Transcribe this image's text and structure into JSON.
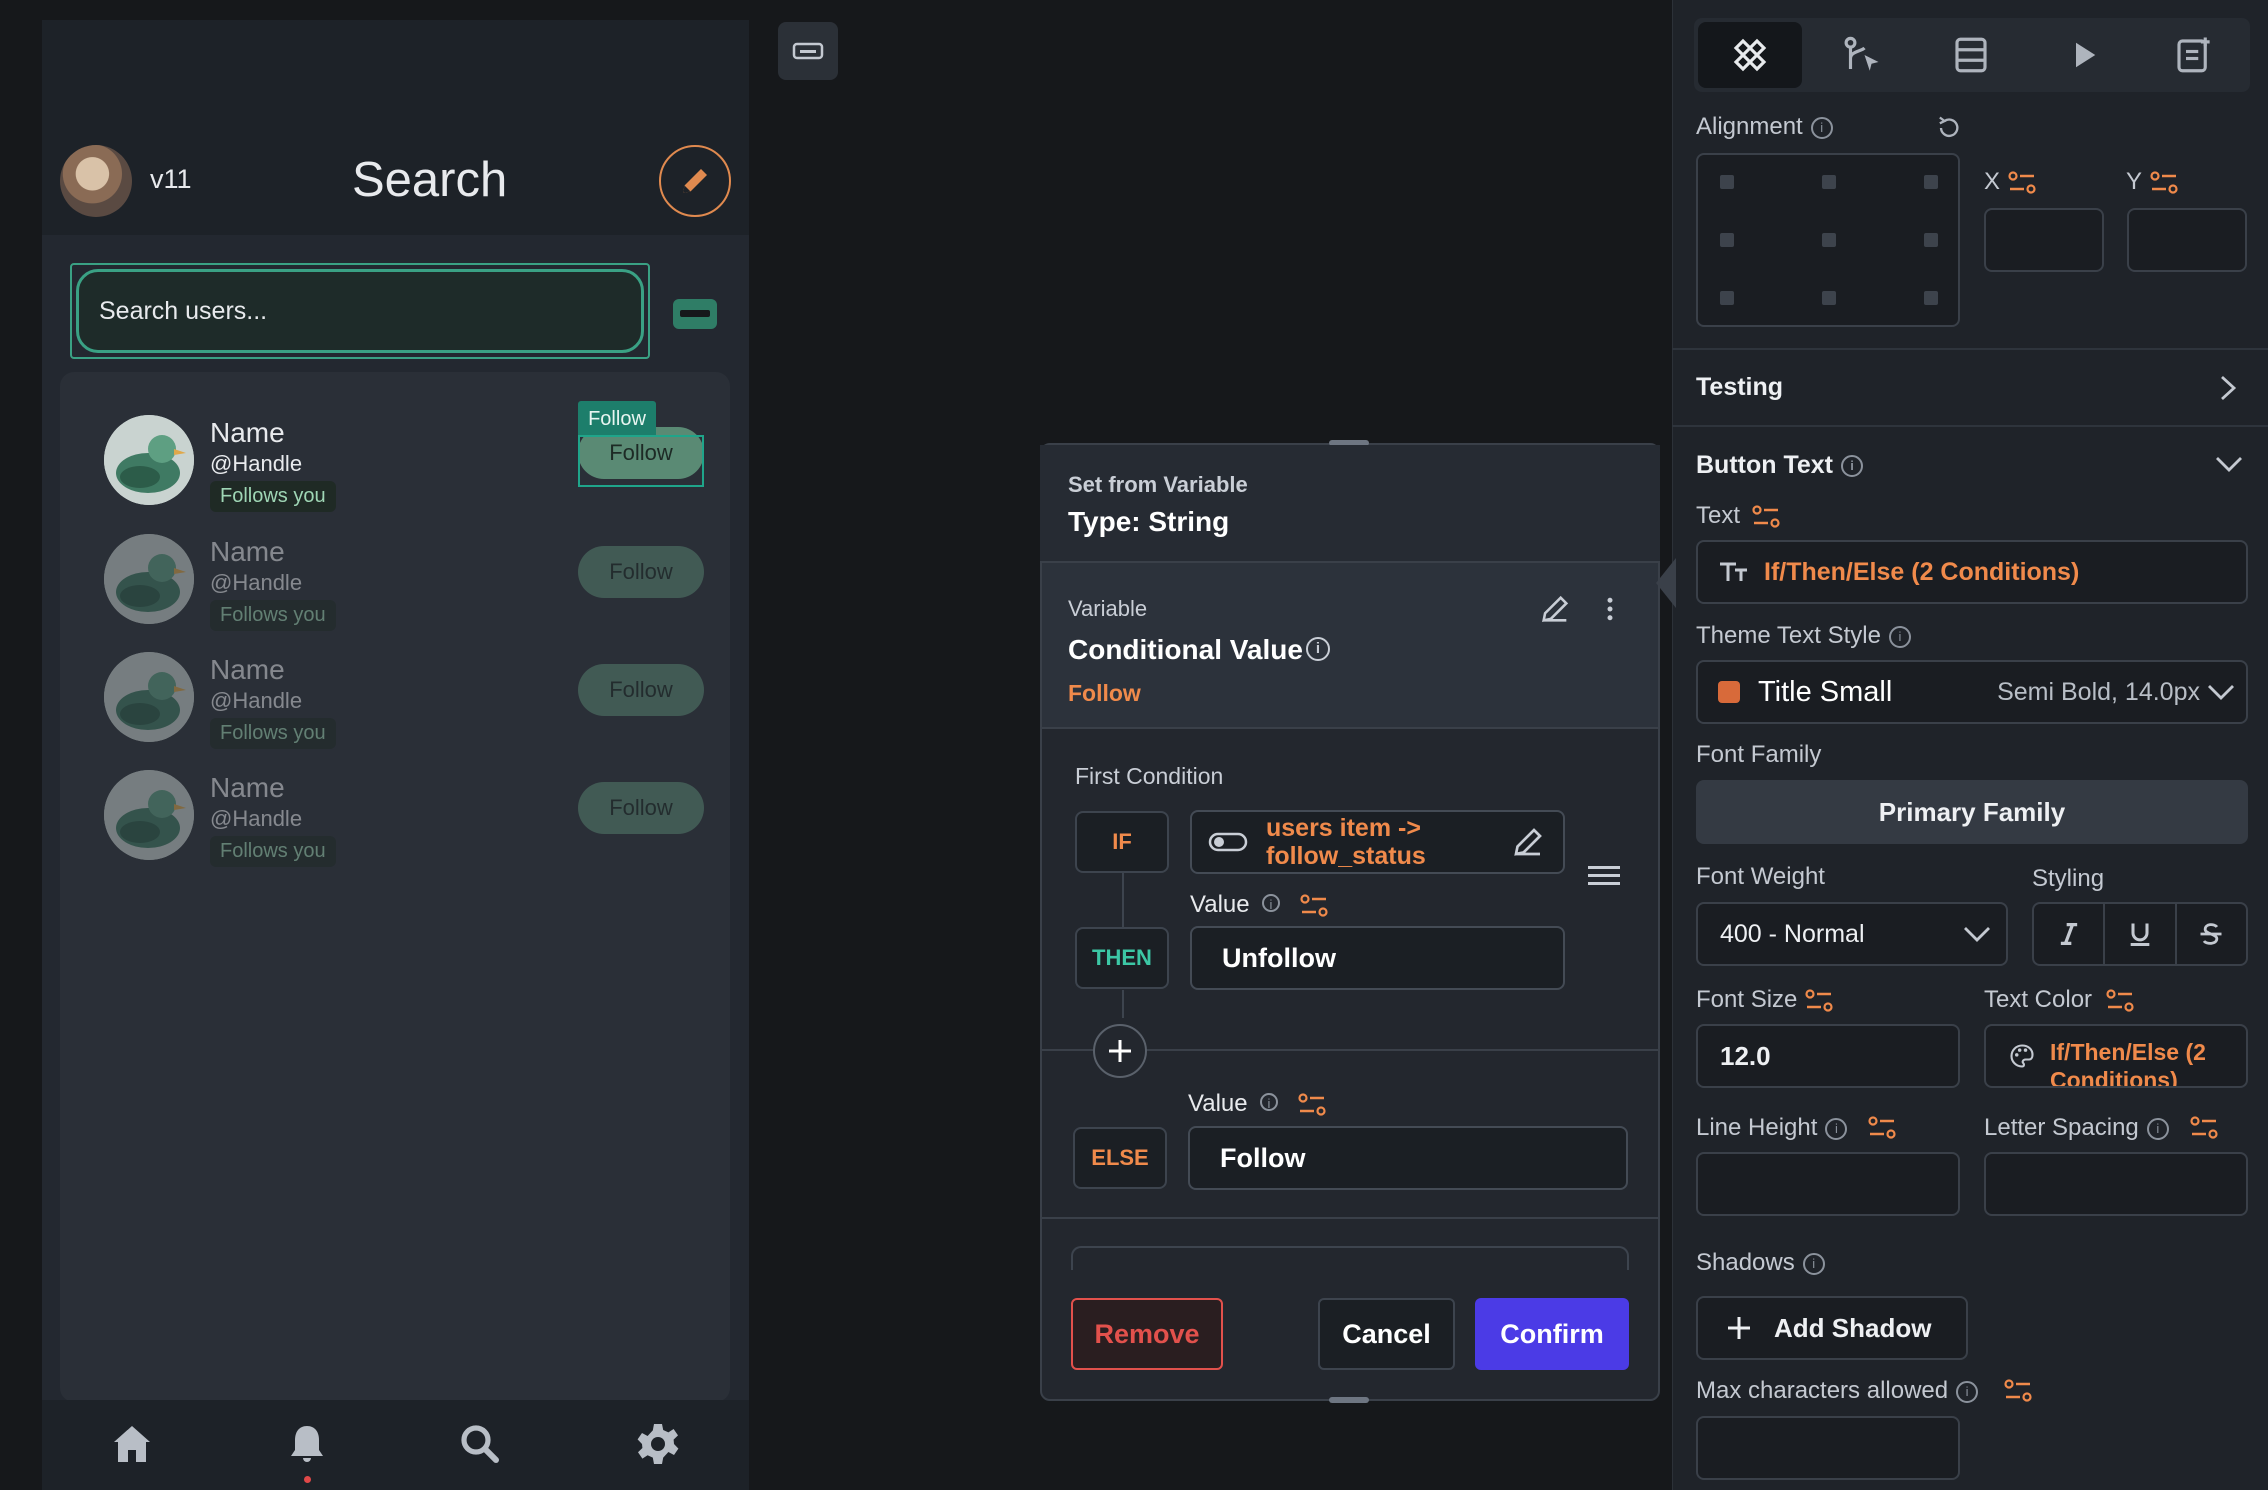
{
  "phone": {
    "version": "v11",
    "title": "Search",
    "search_placeholder": "Search users...",
    "follow_tag": "Follow",
    "users": [
      {
        "name": "Name",
        "handle": "@Handle",
        "badge": "Follows you",
        "button": "Follow"
      },
      {
        "name": "Name",
        "handle": "@Handle",
        "badge": "Follows you",
        "button": "Follow"
      },
      {
        "name": "Name",
        "handle": "@Handle",
        "badge": "Follows you",
        "button": "Follow"
      },
      {
        "name": "Name",
        "handle": "@Handle",
        "badge": "Follows you",
        "button": "Follow"
      }
    ],
    "nav_icons": [
      "home-icon",
      "bell-icon",
      "search-icon",
      "gear-icon"
    ]
  },
  "dialog": {
    "header_label": "Set from Variable",
    "header_type": "Type: String",
    "variable_label": "Variable",
    "variable_name": "Conditional Value",
    "variable_value": "Follow",
    "first_condition": "First Condition",
    "if_label": "IF",
    "if_source_line1": "users item ->",
    "if_source_line2": "follow_status",
    "value_label": "Value",
    "then_label": "THEN",
    "then_value": "Unfollow",
    "else_label": "ELSE",
    "else_value_label": "Value",
    "else_value": "Follow",
    "remove": "Remove",
    "cancel": "Cancel",
    "confirm": "Confirm"
  },
  "panel": {
    "tabs": [
      "widget-properties-icon",
      "actions-icon",
      "backend-query-icon",
      "run-icon",
      "documentation-icon"
    ],
    "alignment_label": "Alignment",
    "x_label": "X",
    "y_label": "Y",
    "testing_label": "Testing",
    "button_text_label": "Button Text",
    "text_label": "Text",
    "text_value": "If/Then/Else (2 Conditions)",
    "theme_text_style_label": "Theme Text Style",
    "theme_style_name": "Title Small",
    "theme_style_detail": "Semi Bold, 14.0px",
    "font_family_label": "Font Family",
    "font_family_value": "Primary Family",
    "font_weight_label": "Font Weight",
    "font_weight_value": "400 - Normal",
    "styling_label": "Styling",
    "font_size_label": "Font Size",
    "font_size_value": "12.0",
    "text_color_label": "Text Color",
    "text_color_line1": "If/Then/Else (2",
    "text_color_line2": "Conditions)",
    "line_height_label": "Line Height",
    "letter_spacing_label": "Letter Spacing",
    "shadows_label": "Shadows",
    "add_shadow": "Add Shadow",
    "max_chars_label": "Max characters allowed"
  },
  "colors": {
    "accent_orange": "#f08a4b",
    "confirm_blue": "#4b3be6",
    "teal": "#3aa184",
    "remove_red": "#e2514c"
  }
}
